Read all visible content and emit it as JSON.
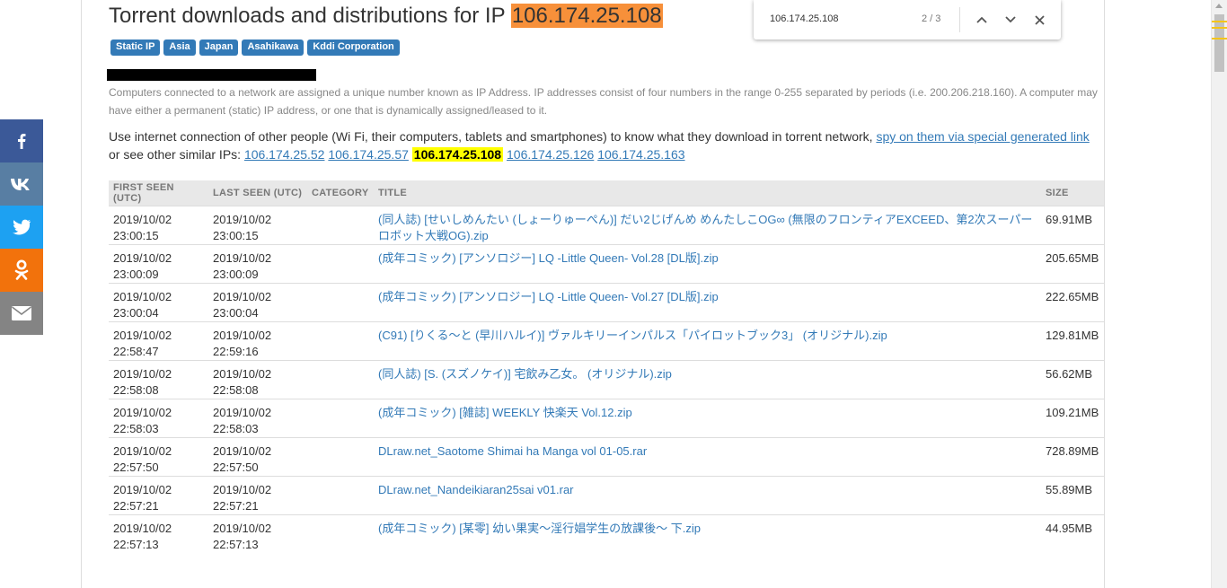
{
  "header": {
    "title_prefix": "Torrent downloads and distributions for IP",
    "ip": "106.174.25.108"
  },
  "tags": [
    "Static IP",
    "Asia",
    "Japan",
    "Asahikawa",
    "Kddi Corporation"
  ],
  "description": "Computers connected to a network are assigned a unique number known as IP Address. IP addresses consist of four numbers in the range 0-255 separated by periods (i.e. 200.206.218.160). A computer may have either a permanent (static) IP address, or one that is dynamically assigned/leased to it.",
  "usage": {
    "text1": "Use internet connection of other people (Wi Fi, their computers, tablets and smartphones) to know what they download in torrent network, ",
    "spy_link": "spy on them via special generated link",
    "text2": "or see other similar IPs: ",
    "similar_ips": [
      "106.174.25.52",
      "106.174.25.57",
      "106.174.25.108",
      "106.174.25.126",
      "106.174.25.163"
    ]
  },
  "table": {
    "headers": {
      "first_seen": "FIRST SEEN (UTC)",
      "last_seen": "LAST SEEN (UTC)",
      "category": "CATEGORY",
      "title": "TITLE",
      "size": "SIZE"
    },
    "rows": [
      {
        "first_date": "2019/10/02",
        "first_time": "23:00:15",
        "last_date": "2019/10/02",
        "last_time": "23:00:15",
        "category": "",
        "title": "(同人誌) [せいしめんたい (しょーりゅーぺん)] だい2じげんめ めんたしこOG∞ (無限のフロンティアEXCEED、第2次スーパーロボット大戦OG).zip",
        "size": "69.91MB"
      },
      {
        "first_date": "2019/10/02",
        "first_time": "23:00:09",
        "last_date": "2019/10/02",
        "last_time": "23:00:09",
        "category": "",
        "title": "(成年コミック) [アンソロジー] LQ -Little Queen- Vol.28 [DL版].zip",
        "size": "205.65MB"
      },
      {
        "first_date": "2019/10/02",
        "first_time": "23:00:04",
        "last_date": "2019/10/02",
        "last_time": "23:00:04",
        "category": "",
        "title": "(成年コミック) [アンソロジー] LQ -Little Queen- Vol.27 [DL版].zip",
        "size": "222.65MB"
      },
      {
        "first_date": "2019/10/02",
        "first_time": "22:58:47",
        "last_date": "2019/10/02",
        "last_time": "22:59:16",
        "category": "",
        "title": "(C91) [りくる～と (早川ハルイ)] ヴァルキリーインパルス「パイロットブック3」 (オリジナル).zip",
        "size": "129.81MB"
      },
      {
        "first_date": "2019/10/02",
        "first_time": "22:58:08",
        "last_date": "2019/10/02",
        "last_time": "22:58:08",
        "category": "",
        "title": "(同人誌) [S. (スズノケイ)] 宅飲み乙女。 (オリジナル).zip",
        "size": "56.62MB"
      },
      {
        "first_date": "2019/10/02",
        "first_time": "22:58:03",
        "last_date": "2019/10/02",
        "last_time": "22:58:03",
        "category": "",
        "title": "(成年コミック) [雑誌] WEEKLY 快楽天 Vol.12.zip",
        "size": "109.21MB"
      },
      {
        "first_date": "2019/10/02",
        "first_time": "22:57:50",
        "last_date": "2019/10/02",
        "last_time": "22:57:50",
        "category": "",
        "title": "DLraw.net_Saotome Shimai ha Manga vol 01-05.rar",
        "size": "728.89MB"
      },
      {
        "first_date": "2019/10/02",
        "first_time": "22:57:21",
        "last_date": "2019/10/02",
        "last_time": "22:57:21",
        "category": "",
        "title": "DLraw.net_Nandeikiaran25sai v01.rar",
        "size": "55.89MB"
      },
      {
        "first_date": "2019/10/02",
        "first_time": "22:57:13",
        "last_date": "2019/10/02",
        "last_time": "22:57:13",
        "category": "",
        "title": "(成年コミック) [某零] 幼い果実～淫行娼学生の放課後～ 下.zip",
        "size": "44.95MB"
      }
    ]
  },
  "share": {
    "buttons": [
      {
        "name": "facebook",
        "icon": "facebook-icon",
        "glyph": "f",
        "color": "#3b5998"
      },
      {
        "name": "vk",
        "icon": "vk-icon",
        "glyph": "vk",
        "color": "#587ea3"
      },
      {
        "name": "twitter",
        "icon": "twitter-icon",
        "glyph": "bird",
        "color": "#1da1f2"
      },
      {
        "name": "odnoklassniki",
        "icon": "odnoklassniki-icon",
        "glyph": "ok",
        "color": "#f2720c"
      },
      {
        "name": "email",
        "icon": "email-icon",
        "glyph": "envelope",
        "color": "#848484"
      }
    ]
  },
  "findbar": {
    "query": "106.174.25.108",
    "count": "2 / 3"
  },
  "colors": {
    "ip_highlight": "#f7903a",
    "similar_ip_highlight": "#ffff00",
    "tag_bg": "#337ab7",
    "link": "#337ab7"
  }
}
